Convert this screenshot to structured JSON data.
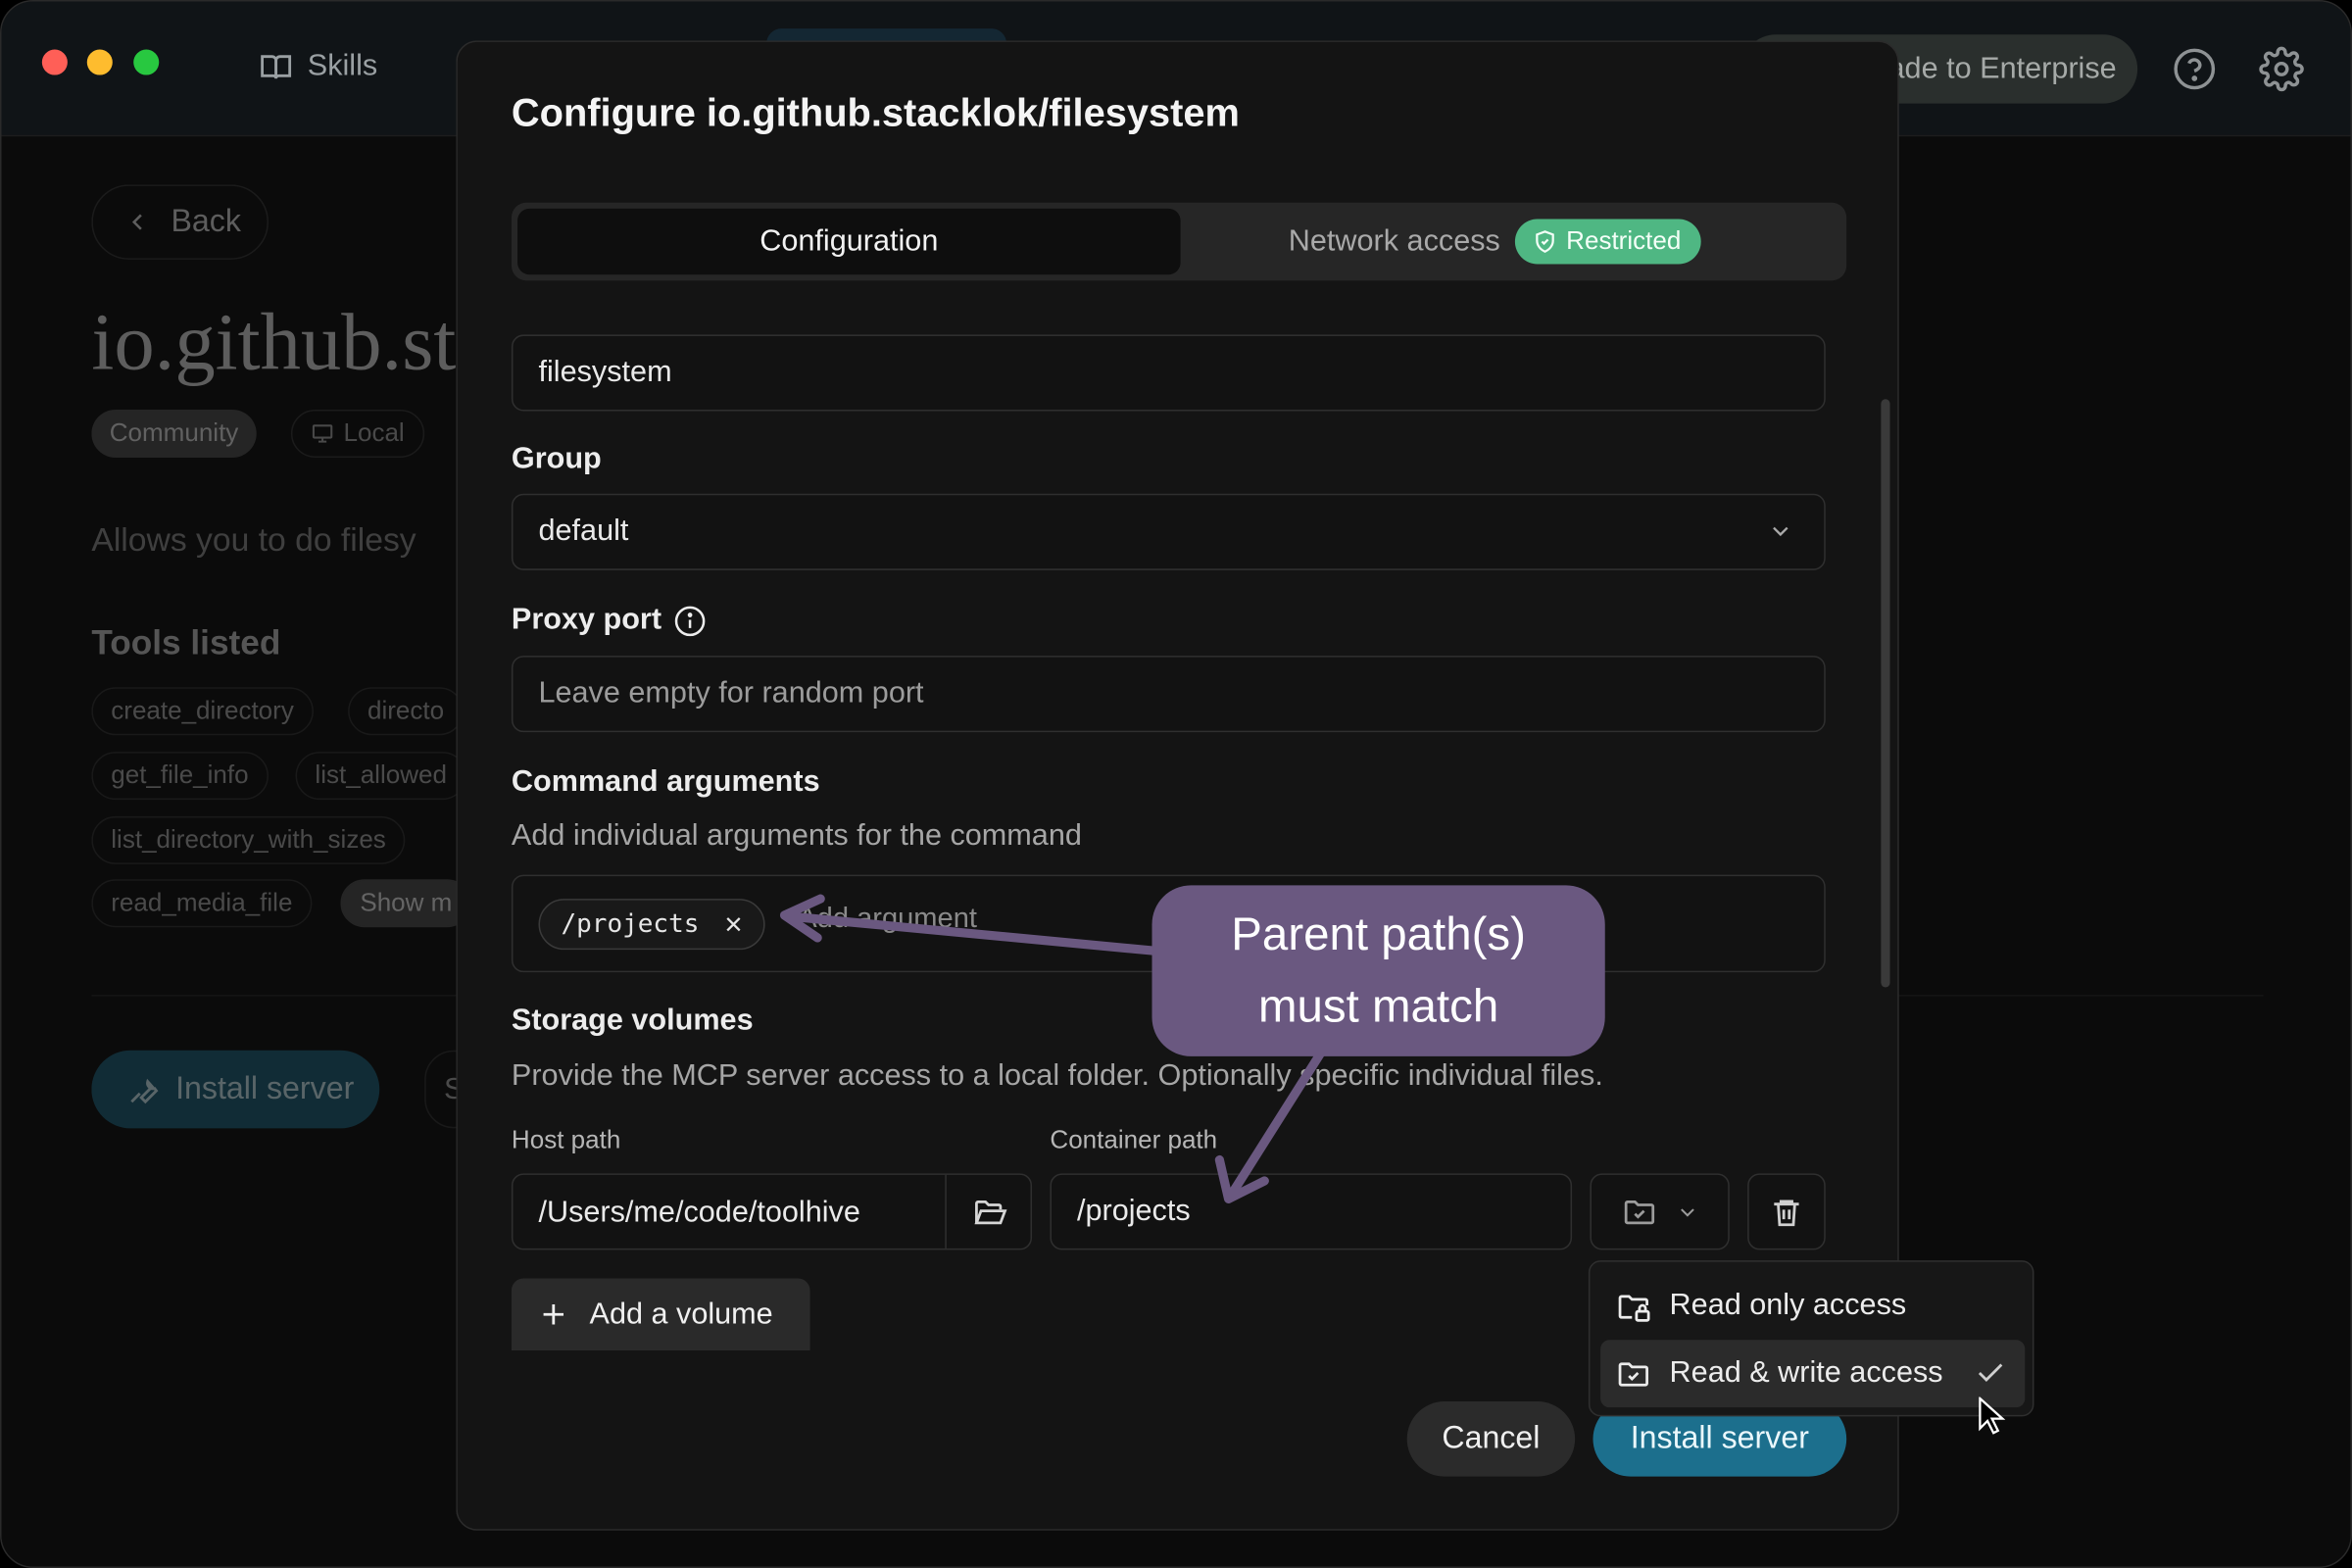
{
  "titlebar": {
    "nav_skills_label": "Skills",
    "enterprise_label": "Upgrade to Enterprise"
  },
  "background": {
    "back_label": "Back",
    "server_title": "io.github.st",
    "badge_community": "Community",
    "badge_local": "Local",
    "description": "Allows you to do filesy",
    "tools_heading": "Tools listed",
    "tools": [
      "create_directory",
      "directo",
      "get_file_info",
      "list_allowed",
      "list_directory_with_sizes",
      "read_media_file",
      "Show m"
    ],
    "install_label": "Install server",
    "install_secondary": "S"
  },
  "dialog": {
    "title": "Configure io.github.stacklok/filesystem",
    "tabs": {
      "configuration": "Configuration",
      "network_access": "Network access",
      "restricted_badge": "Restricted"
    },
    "name_value": "filesystem",
    "group": {
      "label": "Group",
      "value": "default"
    },
    "proxy_port": {
      "label": "Proxy port",
      "placeholder": "Leave empty for random port"
    },
    "command_arguments": {
      "label": "Command arguments",
      "description": "Add individual arguments for the command",
      "tags": [
        "/projects"
      ],
      "input_placeholder": "Add argument"
    },
    "storage_volumes": {
      "label": "Storage volumes",
      "description": "Provide the MCP server access to a local folder. Optionally specific individual files.",
      "host_path_label": "Host path",
      "container_path_label": "Container path",
      "host_path_value": "/Users/me/code/toolhive",
      "container_path_value": "/projects",
      "add_volume_label": "Add a volume"
    },
    "cancel_label": "Cancel",
    "install_label": "Install server"
  },
  "access_dropdown": {
    "options": [
      "Read only access",
      "Read & write access"
    ],
    "selected": "Read & write access"
  },
  "annotation": {
    "line1": "Parent path(s)",
    "line2": "must match",
    "color": "#6a5880"
  },
  "colors": {
    "accent_install": "#1c6f8d",
    "restricted_badge": "#4fb783"
  },
  "icons": [
    "book-icon",
    "help-icon",
    "gear-icon",
    "chevron-left-icon",
    "chevron-down-icon",
    "info-icon",
    "shield-check-icon",
    "close-icon",
    "folder-open-icon",
    "folder-check-icon",
    "trash-icon",
    "plus-icon",
    "folder-lock-icon",
    "check-icon",
    "cursor-icon",
    "wrench-icon",
    "monitor-icon"
  ]
}
